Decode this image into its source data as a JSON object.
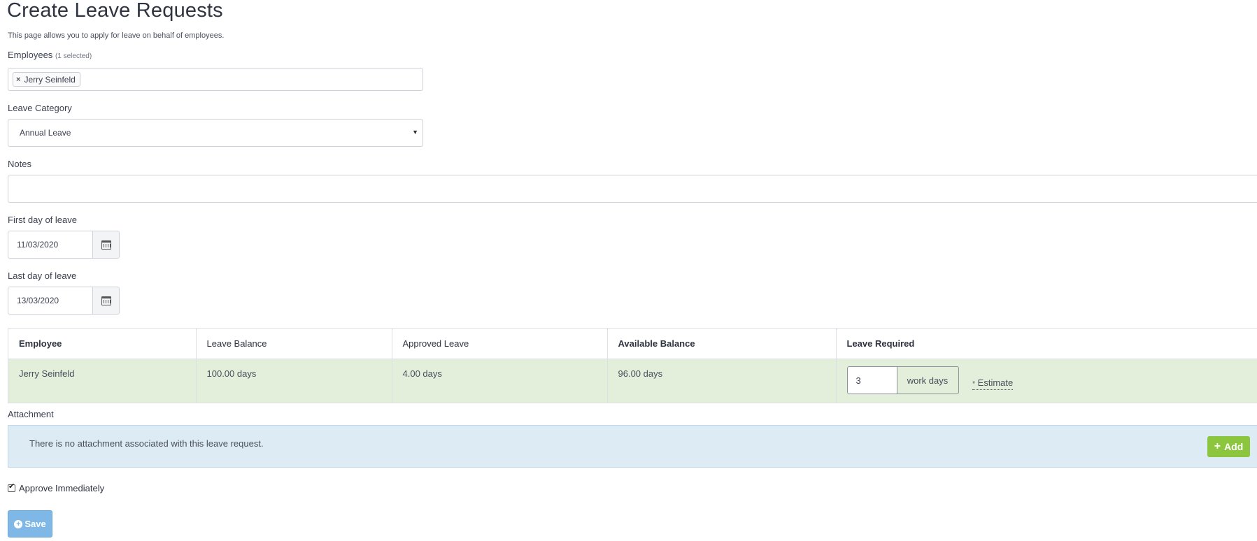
{
  "page": {
    "title": "Create Leave Requests",
    "subtitle": "This page allows you to apply for leave on behalf of employees."
  },
  "employees": {
    "label": "Employees",
    "count_note": "(1 selected)",
    "selected": [
      "Jerry Seinfeld"
    ],
    "remove_icon": "×"
  },
  "leave_category": {
    "label": "Leave Category",
    "value": "Annual Leave"
  },
  "notes": {
    "label": "Notes",
    "value": ""
  },
  "first_day": {
    "label": "First day of leave",
    "value": "11/03/2020"
  },
  "last_day": {
    "label": "Last day of leave",
    "value": "13/03/2020"
  },
  "table": {
    "headers": [
      "Employee",
      "Leave Balance",
      "Approved Leave",
      "Available Balance",
      "Leave Required"
    ],
    "rows": [
      {
        "employee": "Jerry Seinfeld",
        "leave_balance": "100.00 days",
        "approved_leave": "4.00 days",
        "available_balance": "96.00 days",
        "leave_required": "3",
        "unit": "work days",
        "estimate_star": "*",
        "estimate_label": "Estimate"
      }
    ]
  },
  "attachment": {
    "label": "Attachment",
    "message": "There is no attachment associated with this leave request.",
    "add_label": "Add"
  },
  "approve": {
    "label": "Approve Immediately",
    "checked": true
  },
  "save": {
    "label": "Save"
  },
  "colors": {
    "row_success": "#e3efdb",
    "info_box": "#ddebf5",
    "add_button": "#8cc63f",
    "save_button": "#7fb8e6"
  }
}
